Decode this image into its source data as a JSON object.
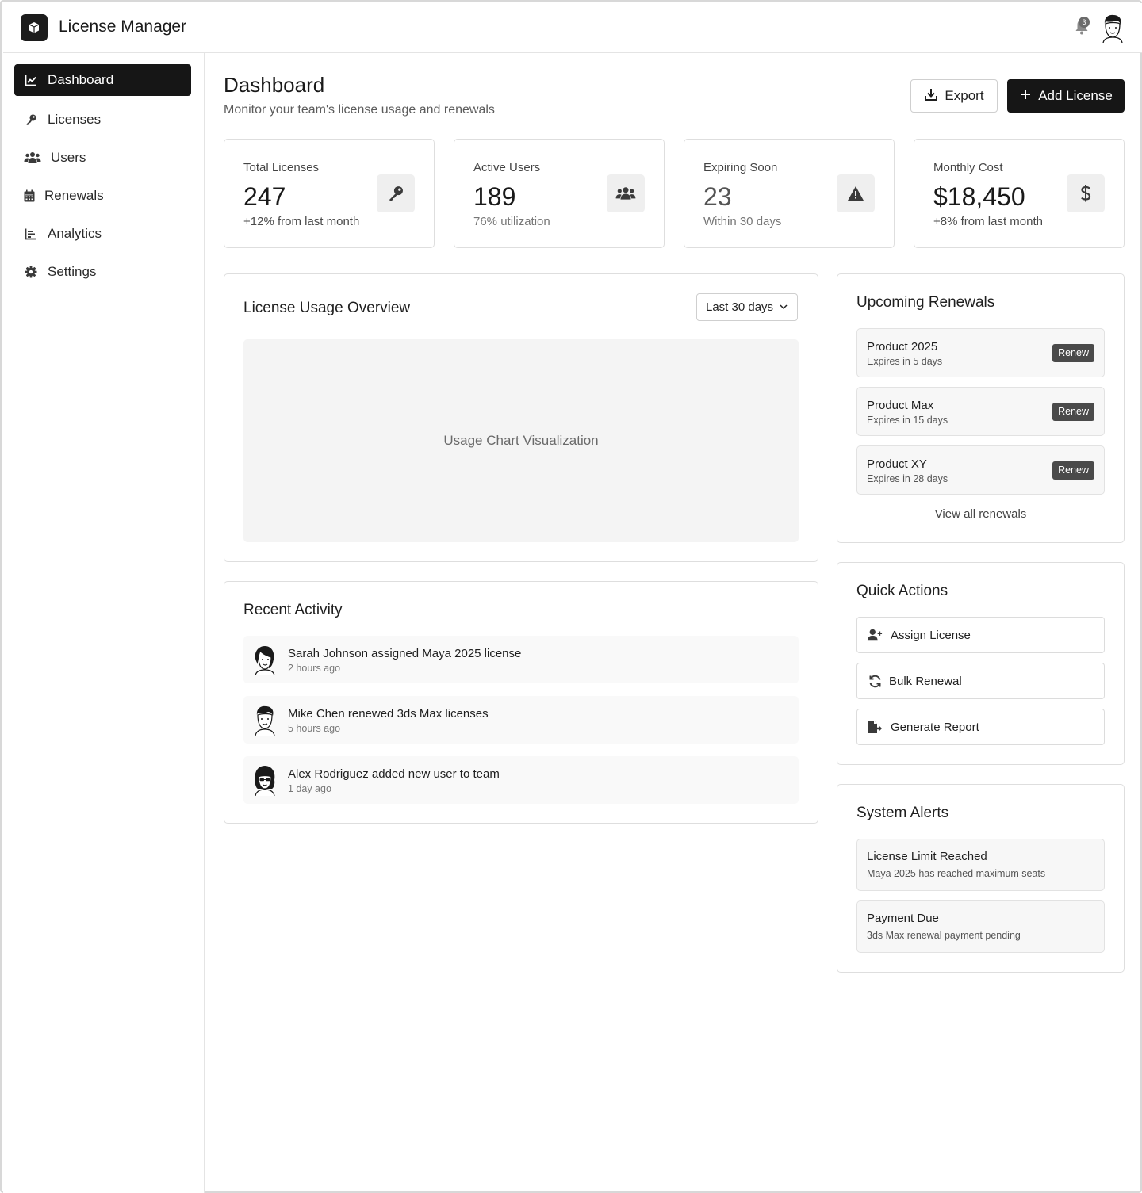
{
  "app": {
    "title": "License Manager",
    "notification_count": "3"
  },
  "sidebar": {
    "items": [
      {
        "label": "Dashboard",
        "icon": "chart-line-icon",
        "active": true
      },
      {
        "label": "Licenses",
        "icon": "key-icon"
      },
      {
        "label": "Users",
        "icon": "users-icon"
      },
      {
        "label": "Renewals",
        "icon": "calendar-icon"
      },
      {
        "label": "Analytics",
        "icon": "bar-chart-icon"
      },
      {
        "label": "Settings",
        "icon": "gear-icon"
      }
    ]
  },
  "page": {
    "title": "Dashboard",
    "subtitle": "Monitor your team's license usage and renewals",
    "export_label": "Export",
    "add_label": "Add License"
  },
  "stats": [
    {
      "label": "Total Licenses",
      "value": "247",
      "sub": "+12% from last month",
      "icon": "key-icon"
    },
    {
      "label": "Active Users",
      "value": "189",
      "sub": "76% utilization",
      "icon": "users-icon"
    },
    {
      "label": "Expiring Soon",
      "value": "23",
      "sub": "Within 30 days",
      "icon": "warning-icon"
    },
    {
      "label": "Monthly Cost",
      "value": "$18,450",
      "sub": "+8% from last month",
      "icon": "dollar-icon"
    }
  ],
  "usage": {
    "title": "License Usage Overview",
    "range": "Last 30 days",
    "placeholder": "Usage Chart Visualization"
  },
  "activity": {
    "title": "Recent Activity",
    "items": [
      {
        "text": "Sarah Johnson assigned Maya 2025 license",
        "time": "2 hours ago"
      },
      {
        "text": "Mike Chen renewed 3ds Max licenses",
        "time": "5 hours ago"
      },
      {
        "text": "Alex Rodriguez added new user to team",
        "time": "1 day ago"
      }
    ]
  },
  "renewals": {
    "title": "Upcoming Renewals",
    "button_label": "Renew",
    "items": [
      {
        "name": "Product 2025",
        "expires": "Expires in 5 days"
      },
      {
        "name": "Product Max",
        "expires": "Expires in 15 days"
      },
      {
        "name": "Product XY",
        "expires": "Expires in 28 days"
      }
    ],
    "view_all": "View all renewals"
  },
  "quick_actions": {
    "title": "Quick Actions",
    "items": [
      {
        "label": "Assign License",
        "icon": "user-plus-icon"
      },
      {
        "label": "Bulk Renewal",
        "icon": "refresh-icon"
      },
      {
        "label": "Generate Report",
        "icon": "file-export-icon"
      }
    ]
  },
  "alerts": {
    "title": "System Alerts",
    "items": [
      {
        "title": "License Limit Reached",
        "desc": "Maya 2025 has reached maximum seats"
      },
      {
        "title": "Payment Due",
        "desc": "3ds Max renewal payment pending"
      }
    ]
  }
}
